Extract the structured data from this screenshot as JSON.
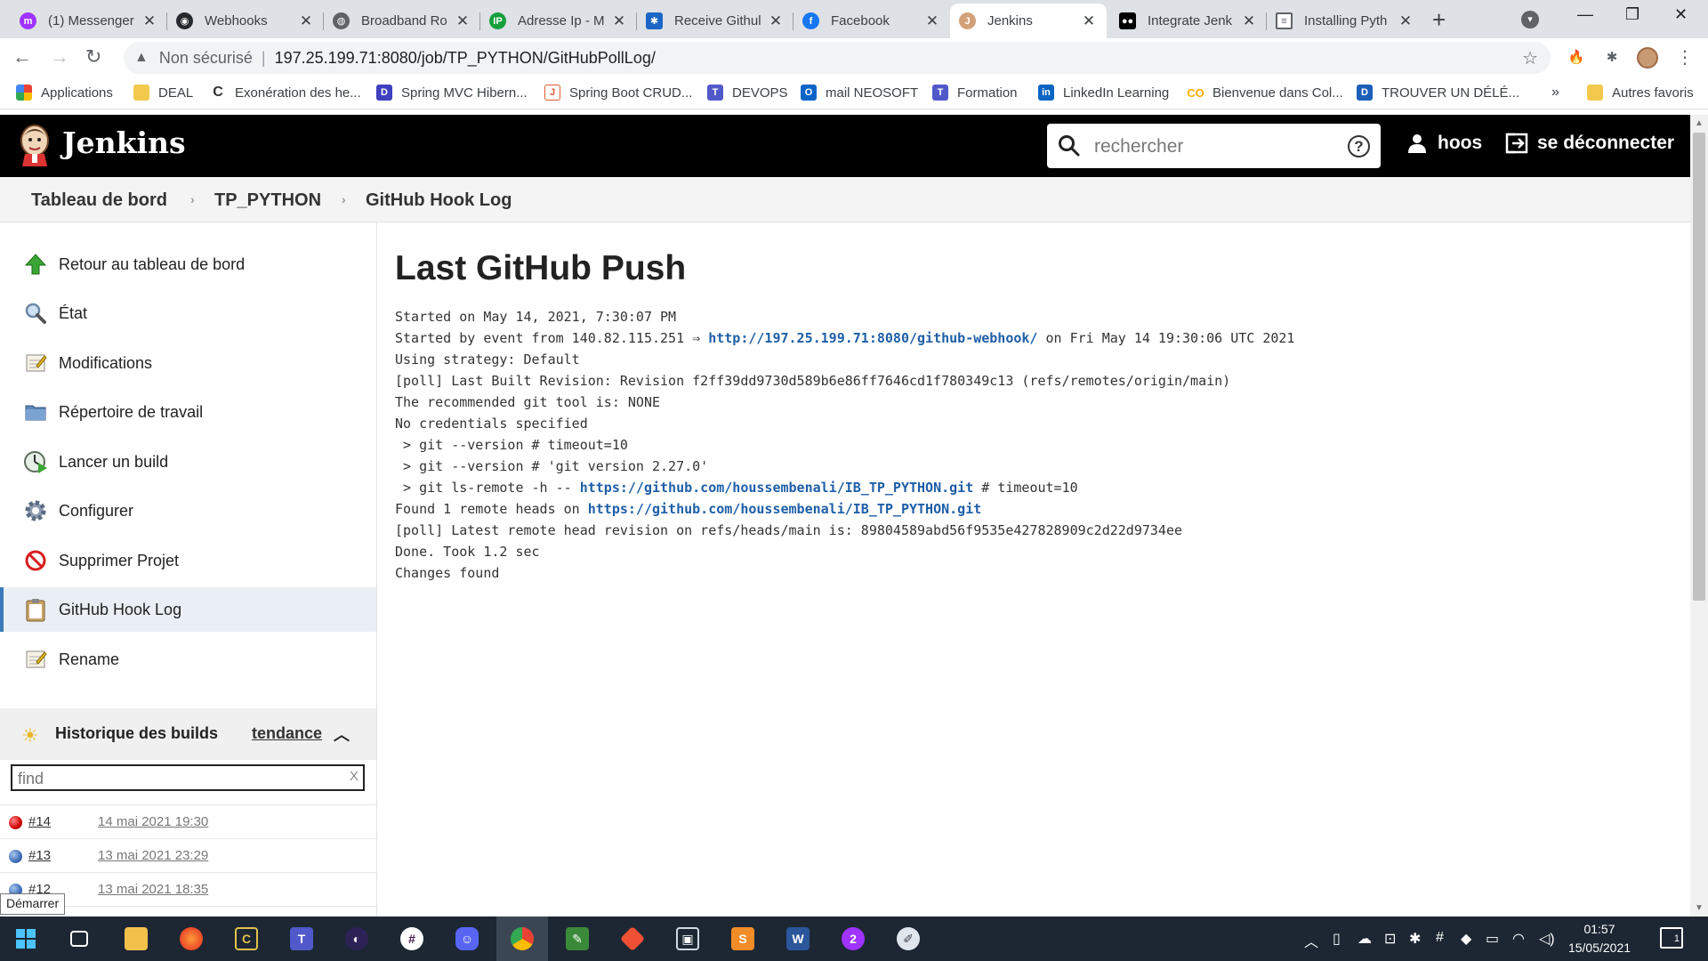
{
  "browser": {
    "tabs": [
      {
        "title": "(1) Messenger",
        "icon": "messenger-icon",
        "color": "#a033ff"
      },
      {
        "title": "Webhooks",
        "icon": "github-icon",
        "color": "#24292e"
      },
      {
        "title": "Broadband Ro",
        "icon": "globe-icon",
        "color": "#5f6368"
      },
      {
        "title": "Adresse Ip - M",
        "icon": "ip-icon",
        "color": "#15a03c"
      },
      {
        "title": "Receive Githul",
        "icon": "puzzle-icon",
        "color": "#1d66c6"
      },
      {
        "title": "Facebook",
        "icon": "facebook-icon",
        "color": "#1877f2"
      },
      {
        "title": "Jenkins",
        "icon": "jenkins-icon",
        "color": "#d2a178"
      },
      {
        "title": "Integrate Jenk",
        "icon": "medium-icon",
        "color": "#000000"
      },
      {
        "title": "Installing Pyth",
        "icon": "document-icon",
        "color": "#5f6368"
      }
    ],
    "address": {
      "security_label": "Non sécurisé",
      "url": "197.25.199.71:8080/job/TP_PYTHON/GitHubPollLog/"
    },
    "bookmarks": [
      {
        "label": "Applications",
        "icon": "apps-grid-icon",
        "color": "#4285f4"
      },
      {
        "label": "DEAL",
        "icon": "folder-icon",
        "color": "#f2c94c"
      },
      {
        "label": "Exonération des he...",
        "icon": "c-logo-icon",
        "color": "#333333"
      },
      {
        "label": "Spring MVC Hibern...",
        "icon": "d-logo-icon",
        "color": "#3f3fbf"
      },
      {
        "label": "Spring Boot CRUD...",
        "icon": "j-logo-icon",
        "color": "#e05a2b"
      },
      {
        "label": "DEVOPS",
        "icon": "teams-icon",
        "color": "#5059c9"
      },
      {
        "label": "mail NEOSOFT",
        "icon": "outlook-icon",
        "color": "#0a64c8"
      },
      {
        "label": "Formation",
        "icon": "teams-icon",
        "color": "#5059c9"
      },
      {
        "label": "LinkedIn Learning",
        "icon": "linkedin-icon",
        "color": "#0a66c2"
      },
      {
        "label": "Bienvenue dans Col...",
        "icon": "colab-icon",
        "color": "#f9ab00"
      },
      {
        "label": "TROUVER UN DÉLÉ...",
        "icon": "d-logo-icon",
        "color": "#1c5fb8"
      }
    ],
    "bookmarks_more": "»",
    "other_bookmarks": "Autres favoris"
  },
  "jenkins": {
    "brand": "Jenkins",
    "search": {
      "placeholder": "rechercher"
    },
    "user": "hoos",
    "logout": "se déconnecter",
    "breadcrumb": [
      "Tableau de bord",
      "TP_PYTHON",
      "GitHub Hook Log"
    ],
    "tasks": [
      {
        "label": "Retour au tableau de bord",
        "icon": "arrow-up-icon"
      },
      {
        "label": "État",
        "icon": "magnifier-icon"
      },
      {
        "label": "Modifications",
        "icon": "notepad-icon"
      },
      {
        "label": "Répertoire de travail",
        "icon": "folder-icon"
      },
      {
        "label": "Lancer un build",
        "icon": "clock-play-icon"
      },
      {
        "label": "Configurer",
        "icon": "gear-icon"
      },
      {
        "label": "Supprimer Projet",
        "icon": "no-entry-icon"
      },
      {
        "label": "GitHub Hook Log",
        "icon": "clipboard-icon",
        "active": true
      },
      {
        "label": "Rename",
        "icon": "notepad-icon"
      }
    ],
    "build_history": {
      "title": "Historique des builds",
      "trend": "tendance",
      "find_placeholder": "find",
      "clear": "X",
      "builds": [
        {
          "number": "#14",
          "date": "14 mai 2021 19:30",
          "status": "failed"
        },
        {
          "number": "#13",
          "date": "13 mai 2021 23:29",
          "status": "success"
        },
        {
          "number": "#12",
          "date": "13 mai 2021 18:35",
          "status": "success"
        }
      ]
    },
    "page_title": "Last GitHub Push",
    "log": {
      "line1": "Started on May 14, 2021, 7:30:07 PM",
      "line2_prefix": "Started by event from 140.82.115.251 ⇒ ",
      "line2_link": "http://197.25.199.71:8080/github-webhook/",
      "line2_suffix": " on Fri May 14 19:30:06 UTC 2021",
      "line3": "Using strategy: Default",
      "line4": "[poll] Last Built Revision: Revision f2ff39dd9730d589b6e86ff7646cd1f780349c13 (refs/remotes/origin/main)",
      "line5": "The recommended git tool is: NONE",
      "line6": "No credentials specified",
      "line7": " > git --version # timeout=10",
      "line8": " > git --version # 'git version 2.27.0'",
      "line9_prefix": " > git ls-remote -h -- ",
      "line9_link": "https://github.com/houssembenali/IB_TP_PYTHON.git",
      "line9_suffix": " # timeout=10",
      "line10_prefix": "Found 1 remote heads on ",
      "line10_link": "https://github.com/houssembenali/IB_TP_PYTHON.git",
      "line11": "[poll] Latest remote head revision on refs/heads/main is: 89804589abd56f9535e427828909c2d22d9734ee",
      "line12": "Done. Took 1.2 sec",
      "line13": "Changes found"
    }
  },
  "tooltip": "Démarrer",
  "taskbar": {
    "time": "01:57",
    "date": "15/05/2021",
    "notifications": "1"
  }
}
